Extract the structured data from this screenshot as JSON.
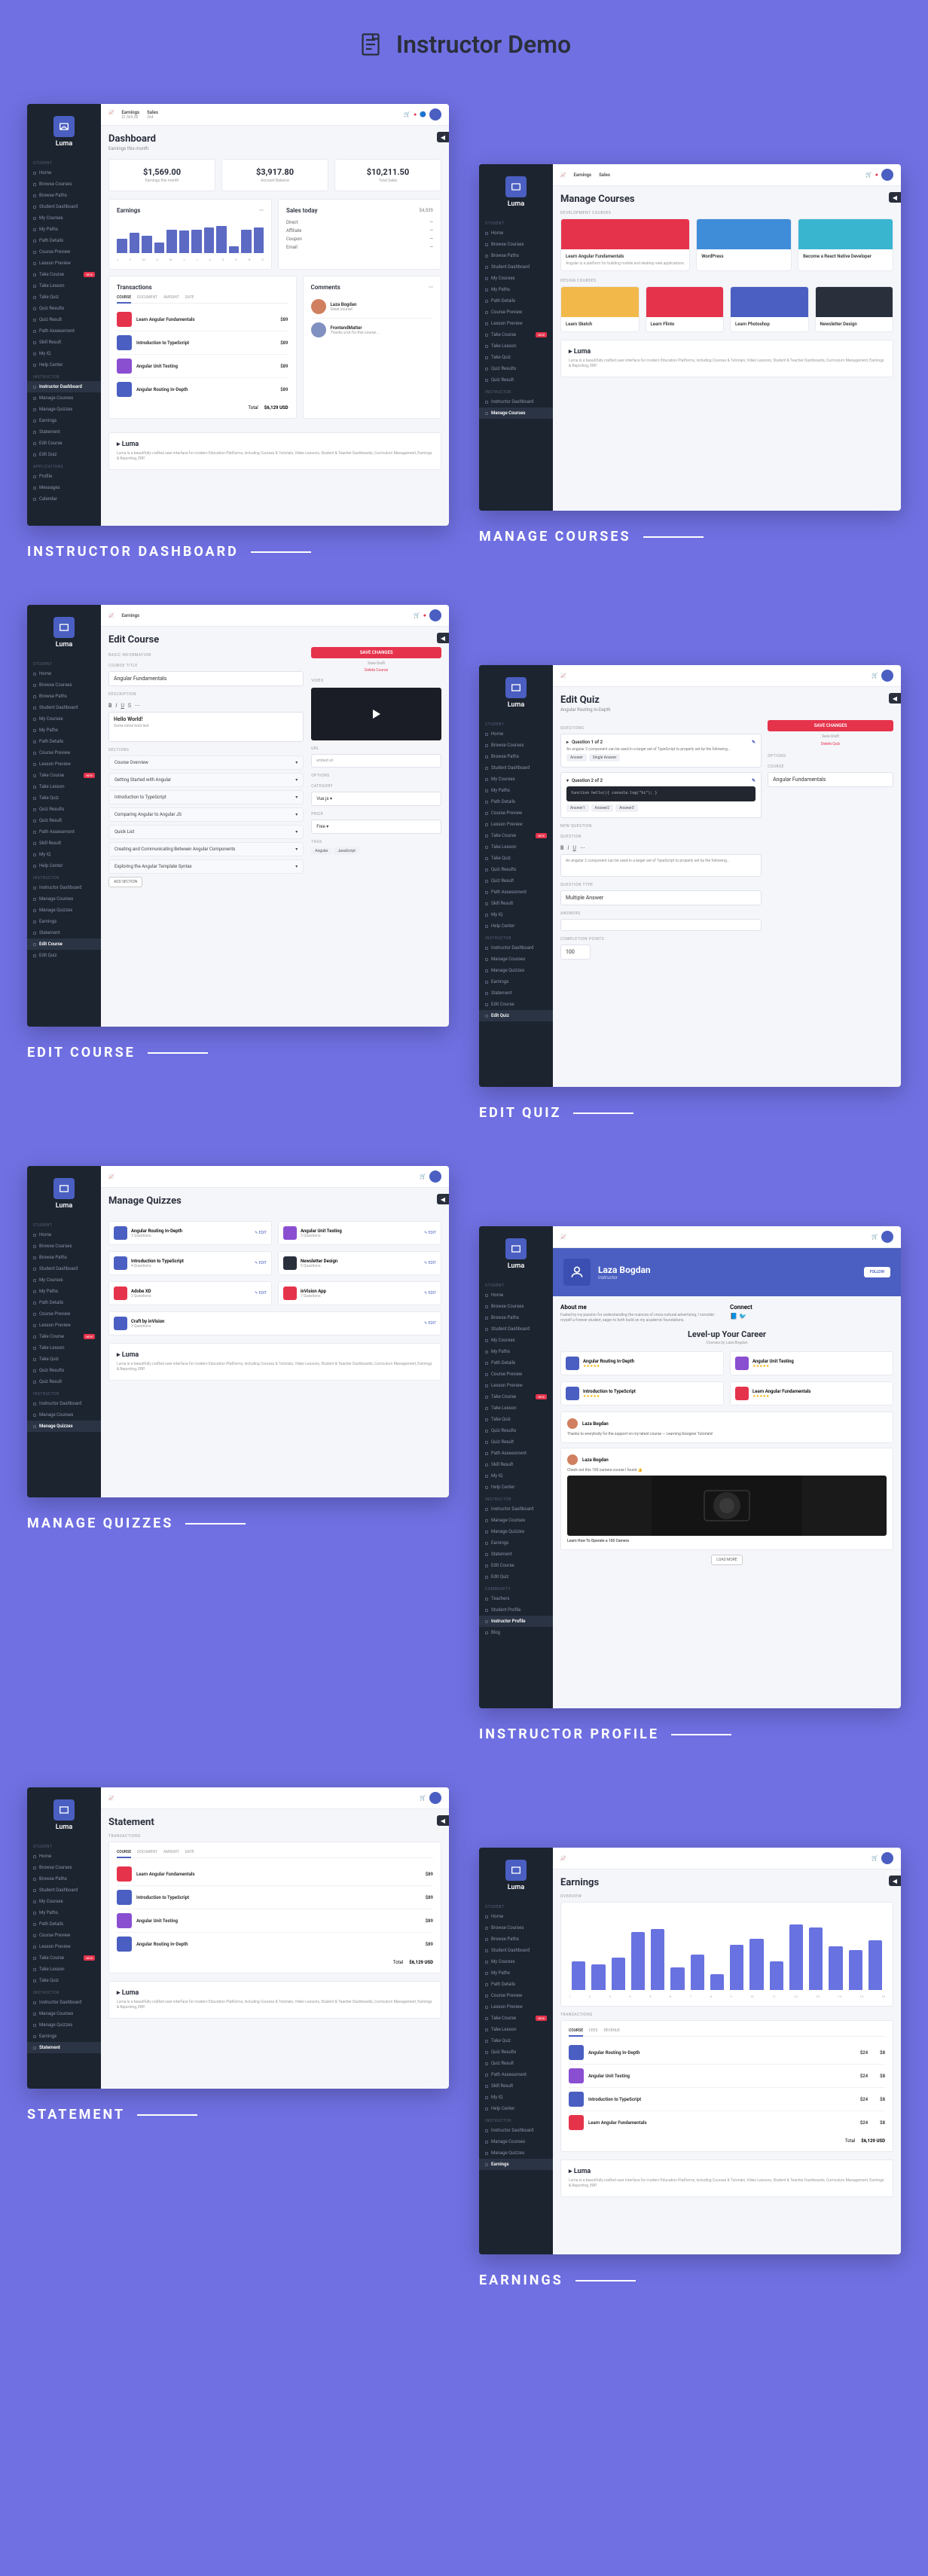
{
  "header": {
    "title": "Instructor Demo"
  },
  "brand": "Luma",
  "topbar": {
    "earnings_label": "Earnings",
    "earnings_value": "$1,569.00",
    "sales_label": "Sales",
    "sales_value": "264"
  },
  "sidebar": {
    "student_section": "STUDENT",
    "student_items": [
      "Home",
      "Browse Courses",
      "Browse Paths",
      "Student Dashboard",
      "My Courses",
      "My Paths",
      "Path Details",
      "Course Preview",
      "Lesson Preview",
      "Take Course",
      "Take Lesson",
      "Take Quiz",
      "Quiz Results",
      "Quiz Result",
      "Path Assessment",
      "Skill Result",
      "My IQ",
      "Help Center"
    ],
    "new_badge": "NEW",
    "instructor_section": "INSTRUCTOR",
    "instructor_items": [
      "Instructor Dashboard",
      "Manage Courses",
      "Manage Quizzes",
      "Earnings",
      "Statement",
      "Edit Course",
      "Edit Quiz"
    ],
    "apps_section": "APPLICATIONS",
    "community_items": [
      "Profile",
      "Messages",
      "Calendar"
    ]
  },
  "captions": {
    "dashboard": "INSTRUCTOR DASHBOARD",
    "manage_courses": "MANAGE COURSES",
    "edit_course": "EDIT COURSE",
    "edit_quiz": "EDIT QUIZ",
    "manage_quizzes": "MANAGE QUIZZES",
    "profile": "INSTRUCTOR PROFILE",
    "statement": "STATEMENT",
    "earnings": "EARNINGS"
  },
  "dashboard": {
    "title": "Dashboard",
    "subtitle": "Earnings this month",
    "stats": [
      {
        "value": "$1,569.00",
        "label": "Earnings this month"
      },
      {
        "value": "$3,917.80",
        "label": "Account Balance"
      },
      {
        "value": "$10,211.50",
        "label": "Total Sales"
      }
    ],
    "earnings_panel": "Earnings",
    "sales_panel": "Sales today",
    "sales_amount": "$4,535",
    "sales_items": [
      "Direct",
      "Affiliate",
      "Coupon",
      "Email"
    ],
    "transactions_panel": "Transactions",
    "comments_panel": "Comments",
    "tabs": [
      "COURSE",
      "DOCUMENT",
      "AMOUNT",
      "DATE"
    ],
    "transactions": [
      {
        "title": "Learn Angular Fundamentals",
        "color": "#e6334c"
      },
      {
        "title": "Introduction to TypeScript",
        "color": "#4a5fc1"
      },
      {
        "title": "Angular Unit Testing",
        "color": "#8a4fd1"
      },
      {
        "title": "Angular Routing In-Depth",
        "color": "#4a5fc1"
      }
    ],
    "total_label": "Total",
    "total_value": "$6,129 USD",
    "footer": "Luma is a beautifully crafted user interface for modern Education Platforms, including Courses & Tutorials, Video Lessons, Student & Teacher Dashboards, Curriculum Management, Earnings & Reporting, ERP."
  },
  "chart_data": {
    "type": "bar",
    "categories": [
      "Jan",
      "Feb",
      "Mar",
      "Apr",
      "May",
      "Jun",
      "Jul",
      "Aug",
      "Sep",
      "Oct",
      "Nov",
      "Dec"
    ],
    "values": [
      180,
      260,
      220,
      130,
      300,
      290,
      300,
      320,
      340,
      90,
      300,
      320
    ],
    "title": "Earnings",
    "ylabel": "$",
    "ylim": [
      0,
      400
    ]
  },
  "manage_courses": {
    "title": "Manage Courses",
    "dev_label": "DEVELOPMENT COURSES",
    "design_label": "DESIGN COURSES",
    "featured": {
      "title": "Learn Angular Fundamentals",
      "desc": "Angular is a platform for building mobile and desktop web applications."
    },
    "courses": [
      {
        "title": "Learn Angular Fundamentals",
        "color": "#e6334c"
      },
      {
        "title": "WordPress",
        "color": "#3f8cd9"
      },
      {
        "title": "Become a React Native Developer",
        "color": "#3ab5d0"
      }
    ],
    "design": [
      {
        "title": "Learn Sketch",
        "color": "#f2b94a"
      },
      {
        "title": "Learn Flinto",
        "color": "#e6334c"
      },
      {
        "title": "Learn Photoshop",
        "color": "#4a5fc1"
      },
      {
        "title": "Newsletter Design",
        "color": "#2a2f3c"
      }
    ]
  },
  "edit_course": {
    "title": "Edit Course",
    "basic_label": "BASIC INFORMATION",
    "course_title_label": "COURSE TITLE",
    "course_title": "Angular Fundamentals",
    "desc_label": "DESCRIPTION",
    "desc_content": "Hello World!",
    "desc_sub": "Some initial bold text",
    "sections_label": "SECTIONS",
    "sections": [
      "Course Overview",
      "Getting Started with Angular",
      "Introduction to TypeScript",
      "Comparing Angular to Angular JS",
      "Quick List",
      "Creating and Communicating Between Angular Components",
      "Exploring the Angular Template Syntax"
    ],
    "add_section": "ADD SECTION",
    "save_btn": "SAVE CHANGES",
    "save_draft": "Save Draft",
    "delete": "Delete Course",
    "video_label": "VIDEO",
    "url_label": "URL",
    "options_label": "OPTIONS",
    "category_label": "CATEGORY",
    "price_label": "PRICE",
    "tags_label": "TAGS"
  },
  "edit_quiz": {
    "title": "Edit Quiz",
    "subtitle": "Angular Routing In-Depth",
    "questions_label": "QUESTIONS",
    "q1": "Question 1 of 2",
    "q1_text": "An angular 2 component can be used in a larger set of TypeScript to properly set by the following...",
    "answer_label": "Answer",
    "single_answer": "Single Answer",
    "q2": "Question 2 of 2",
    "code": "function hello(){\n  console.log(\"hi\");\n}",
    "new_q_label": "NEW QUESTION",
    "question_label": "QUESTION",
    "q_type_label": "QUESTION TYPE",
    "q_type": "Multiple Answer",
    "answers_label": "ANSWERS",
    "completion_label": "COMPLETION POINTS",
    "save_btn": "SAVE CHANGES",
    "save_draft": "Save Draft",
    "delete": "Delete Quiz",
    "course_opt": "COURSE",
    "course_val": "Angular Fundamentals"
  },
  "manage_quizzes": {
    "title": "Manage Quizzes",
    "quizzes": [
      {
        "title": "Angular Routing In-Depth",
        "color": "#4a5fc1",
        "meta": "3 Questions"
      },
      {
        "title": "Angular Unit Testing",
        "color": "#8a4fd1",
        "meta": "3 Questions"
      },
      {
        "title": "Introduction to TypeScript",
        "color": "#4a5fc1",
        "meta": "4 Questions"
      },
      {
        "title": "Newsletter Design",
        "color": "#2a2f3c",
        "meta": "5 Questions"
      },
      {
        "title": "Adobe XD",
        "color": "#e6334c",
        "meta": "2 Questions"
      },
      {
        "title": "inVision App",
        "color": "#e6334c",
        "meta": "7 Questions"
      },
      {
        "title": "Craft by inVision",
        "color": "#4a5fc1",
        "meta": "3 Questions"
      }
    ],
    "edit": "✎ EDIT"
  },
  "profile": {
    "name": "Laza Bogdan",
    "role": "Instructor",
    "follow": "FOLLOW",
    "about_h": "About me",
    "connect_h": "Connect",
    "about": "Fueled by my passion for understanding the nuances of cross-cultural advertising, I consider myself a forever student, eager to both build on my academic foundations.",
    "levelup": "Level-up Your Career",
    "levelup_sub": "Courses by Laza Bogdan",
    "courses": [
      {
        "title": "Angular Routing In-Depth",
        "color": "#4a5fc1"
      },
      {
        "title": "Angular Unit Testing",
        "color": "#8a4fd1"
      },
      {
        "title": "Introduction to TypeScript",
        "color": "#4a5fc1"
      },
      {
        "title": "Learn Angular Fundamentals",
        "color": "#e6334c"
      }
    ],
    "post1_name": "Laza Bogdan",
    "post1_text": "Thanks to everybody for the support on my latest course — Learning Designer Tutorials!",
    "post2_text": "Check out this 100 camera course I found 👍",
    "link_title": "Learn How To Operate a 100 Camera",
    "load_more": "LOAD MORE"
  },
  "statement": {
    "title": "Statement",
    "trans_label": "TRANSACTIONS",
    "tabs": [
      "COURSE",
      "DOCUMENT",
      "AMOUNT",
      "DATE"
    ],
    "items": [
      {
        "title": "Learn Angular Fundamentals",
        "color": "#e6334c"
      },
      {
        "title": "Introduction to TypeScript",
        "color": "#4a5fc1"
      },
      {
        "title": "Angular Unit Testing",
        "color": "#8a4fd1"
      },
      {
        "title": "Angular Routing In-Depth",
        "color": "#4a5fc1"
      }
    ],
    "total": "Total",
    "total_val": "$6,129 USD"
  },
  "earnings": {
    "title": "Earnings",
    "overview": "OVERVIEW",
    "trans_label": "TRANSACTIONS",
    "tabs": [
      "COURSE",
      "FEES",
      "REVENUE"
    ],
    "items": [
      {
        "title": "Angular Routing In-Depth",
        "color": "#4a5fc1",
        "fee": "$24",
        "rev": "$8"
      },
      {
        "title": "Angular Unit Testing",
        "color": "#8a4fd1",
        "fee": "$24",
        "rev": "$8"
      },
      {
        "title": "Introduction to TypeScript",
        "color": "#4a5fc1",
        "fee": "$24",
        "rev": "$8"
      },
      {
        "title": "Learn Angular Fundamentals",
        "color": "#e6334c",
        "fee": "$24",
        "rev": "$8"
      }
    ],
    "total": "Total",
    "total_val": "$6,129 USD"
  },
  "earnings_chart": {
    "type": "bar",
    "categories": [
      "1",
      "2",
      "3",
      "4",
      "5",
      "6",
      "7",
      "8",
      "9",
      "10",
      "11",
      "12",
      "13",
      "14",
      "15",
      "16"
    ],
    "values": [
      180,
      160,
      200,
      360,
      380,
      140,
      220,
      100,
      280,
      320,
      180,
      410,
      390,
      270,
      250,
      310
    ],
    "ylim": [
      0,
      450
    ]
  }
}
